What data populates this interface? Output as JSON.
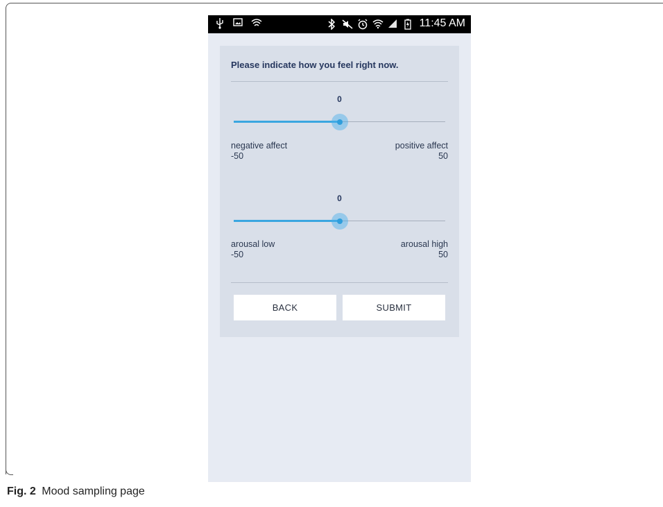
{
  "caption": {
    "fig_label": "Fig. 2",
    "text": "Mood sampling page"
  },
  "statusbar": {
    "icons_left": [
      "usb-icon",
      "image-icon",
      "wifi-hotspot-icon"
    ],
    "icons_right": [
      "bluetooth-icon",
      "mute-icon",
      "alarm-icon",
      "wifi-icon",
      "signal-icon",
      "battery-icon"
    ],
    "time": "11:45 AM"
  },
  "form": {
    "title": "Please indicate how you feel right now.",
    "sliders": [
      {
        "value": "0",
        "min": -50,
        "max": 50,
        "current": 0,
        "left_label": "negative affect",
        "left_value": "-50",
        "right_label": "positive affect",
        "right_value": "50"
      },
      {
        "value": "0",
        "min": -50,
        "max": 50,
        "current": 0,
        "left_label": "arousal low",
        "left_value": "-50",
        "right_label": "arousal high",
        "right_value": "50"
      }
    ],
    "back_label": "BACK",
    "submit_label": "SUBMIT",
    "accent_color": "#3aa6e0"
  }
}
